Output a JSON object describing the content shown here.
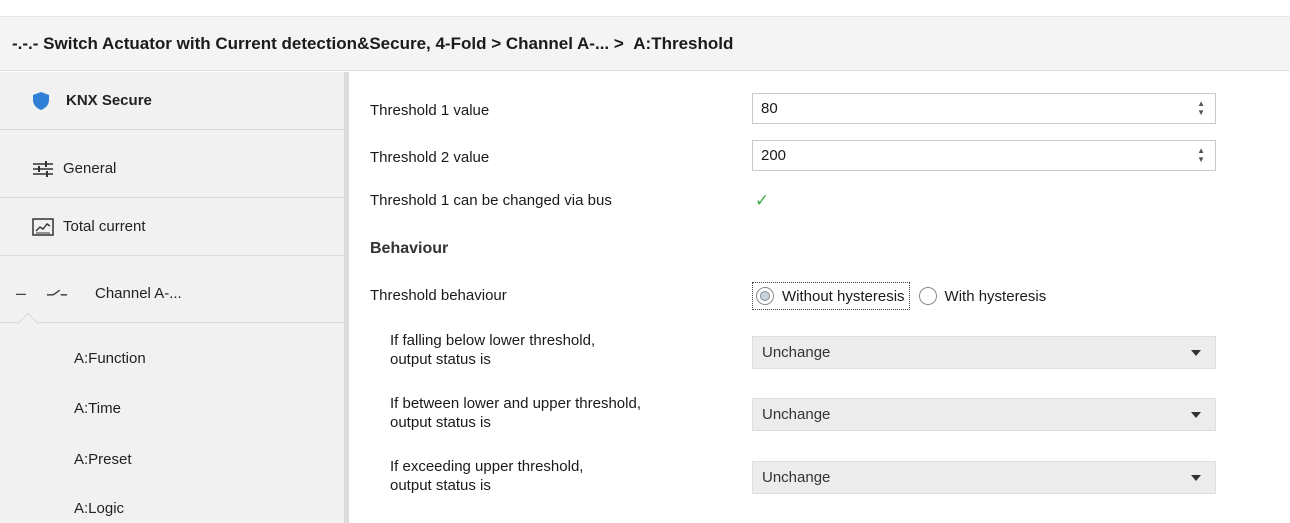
{
  "title": {
    "device": "-.-.- Switch Actuator with Current detection&Secure, 4-Fold",
    "sep1": ">",
    "channel": "Channel A-...",
    "sep2": ">",
    "page": "A:Threshold"
  },
  "sidebar": {
    "items": [
      {
        "label": "KNX Secure",
        "icon": "shield-icon"
      },
      {
        "label": "General",
        "icon": "sliders-icon"
      },
      {
        "label": "Total current",
        "icon": "chart-icon"
      },
      {
        "label": "Channel A-...",
        "icon": "switch-icon",
        "expander": "–"
      }
    ],
    "subitems": [
      "A:Function",
      "A:Time",
      "A:Preset",
      "A:Logic"
    ]
  },
  "form": {
    "threshold1": {
      "label": "Threshold 1 value",
      "value": "80"
    },
    "threshold2": {
      "label": "Threshold 2 value",
      "value": "200"
    },
    "bus_change": {
      "label": "Threshold 1 can be changed via bus",
      "checked": true
    },
    "section_title": "Behaviour",
    "behaviour": {
      "label": "Threshold behaviour",
      "options": [
        "Without hysteresis",
        "With hysteresis"
      ],
      "selected": "Without hysteresis"
    },
    "below": {
      "label_line1": "If falling below lower threshold,",
      "label_line2": "output status is",
      "value": "Unchange"
    },
    "between": {
      "label_line1": "If between lower and upper threshold,",
      "label_line2": "output status is",
      "value": "Unchange"
    },
    "exceeding": {
      "label_line1": "If exceeding upper threshold,",
      "label_line2": "output status is",
      "value": "Unchange"
    }
  },
  "colors": {
    "shield": "#2f7fd6",
    "check": "#43a843",
    "sidebar_bg": "#f1f1f1"
  }
}
